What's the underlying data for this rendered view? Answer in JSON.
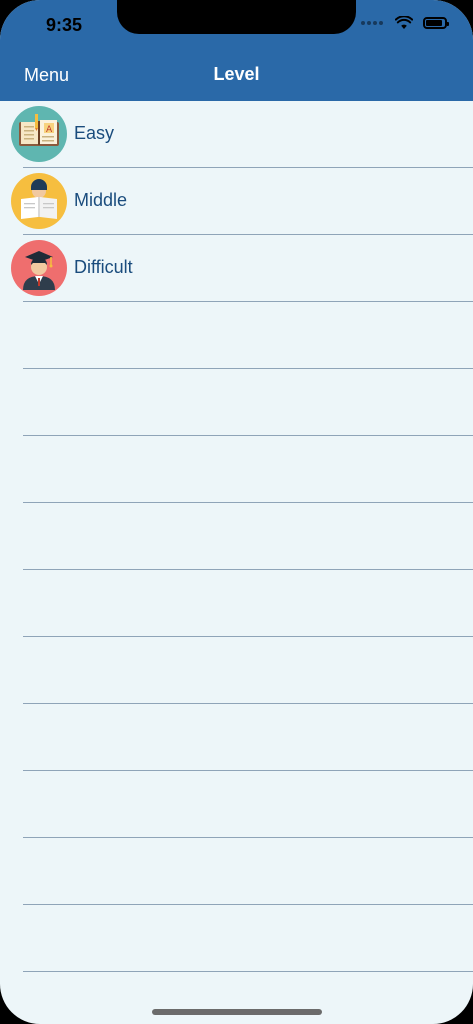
{
  "status_bar": {
    "time": "9:35"
  },
  "nav": {
    "left_label": "Menu",
    "title": "Level"
  },
  "levels": [
    {
      "label": "Easy",
      "icon": "open-book-icon",
      "icon_bg": "#5fb6b0"
    },
    {
      "label": "Middle",
      "icon": "reading-person-icon",
      "icon_bg": "#f6be3f"
    },
    {
      "label": "Difficult",
      "icon": "graduate-icon",
      "icon_bg": "#ef6e6e"
    }
  ],
  "colors": {
    "header": "#2a69a8",
    "background": "#edf6f9",
    "label": "#1a4c7d",
    "separator": "#8fa4b8"
  },
  "battery_level": 0.9
}
